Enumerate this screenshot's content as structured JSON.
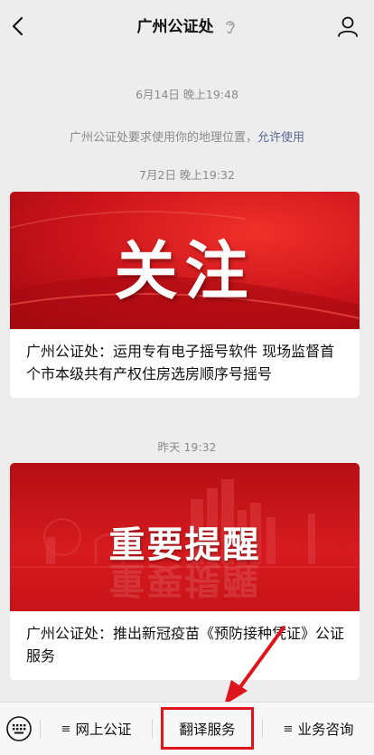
{
  "header": {
    "title": "广州公证处"
  },
  "messages": {
    "time1": "6月14日 晚上19:48",
    "system_prefix": "广州公证处要求使用你的地理位置，",
    "system_link": "允许使用",
    "time2": "7月2日 晚上19:32",
    "card1": {
      "banner_text": "关注",
      "title": "广州公证处：运用专有电子摇号软件 现场监督首个市本级共有产权住房选房顺序号摇号"
    },
    "time3": "昨天 19:32",
    "card2": {
      "banner_text": "重要提醒",
      "title": "广州公证处：推出新冠疫苗《预防接种凭证》公证服务"
    }
  },
  "bottom_menu": {
    "item1": "网上公证",
    "item2": "翻译服务",
    "item3": "业务咨询",
    "menu_icon_glyph": "≡"
  },
  "colors": {
    "accent_red": "#e0141b",
    "link_blue": "#576b95"
  }
}
